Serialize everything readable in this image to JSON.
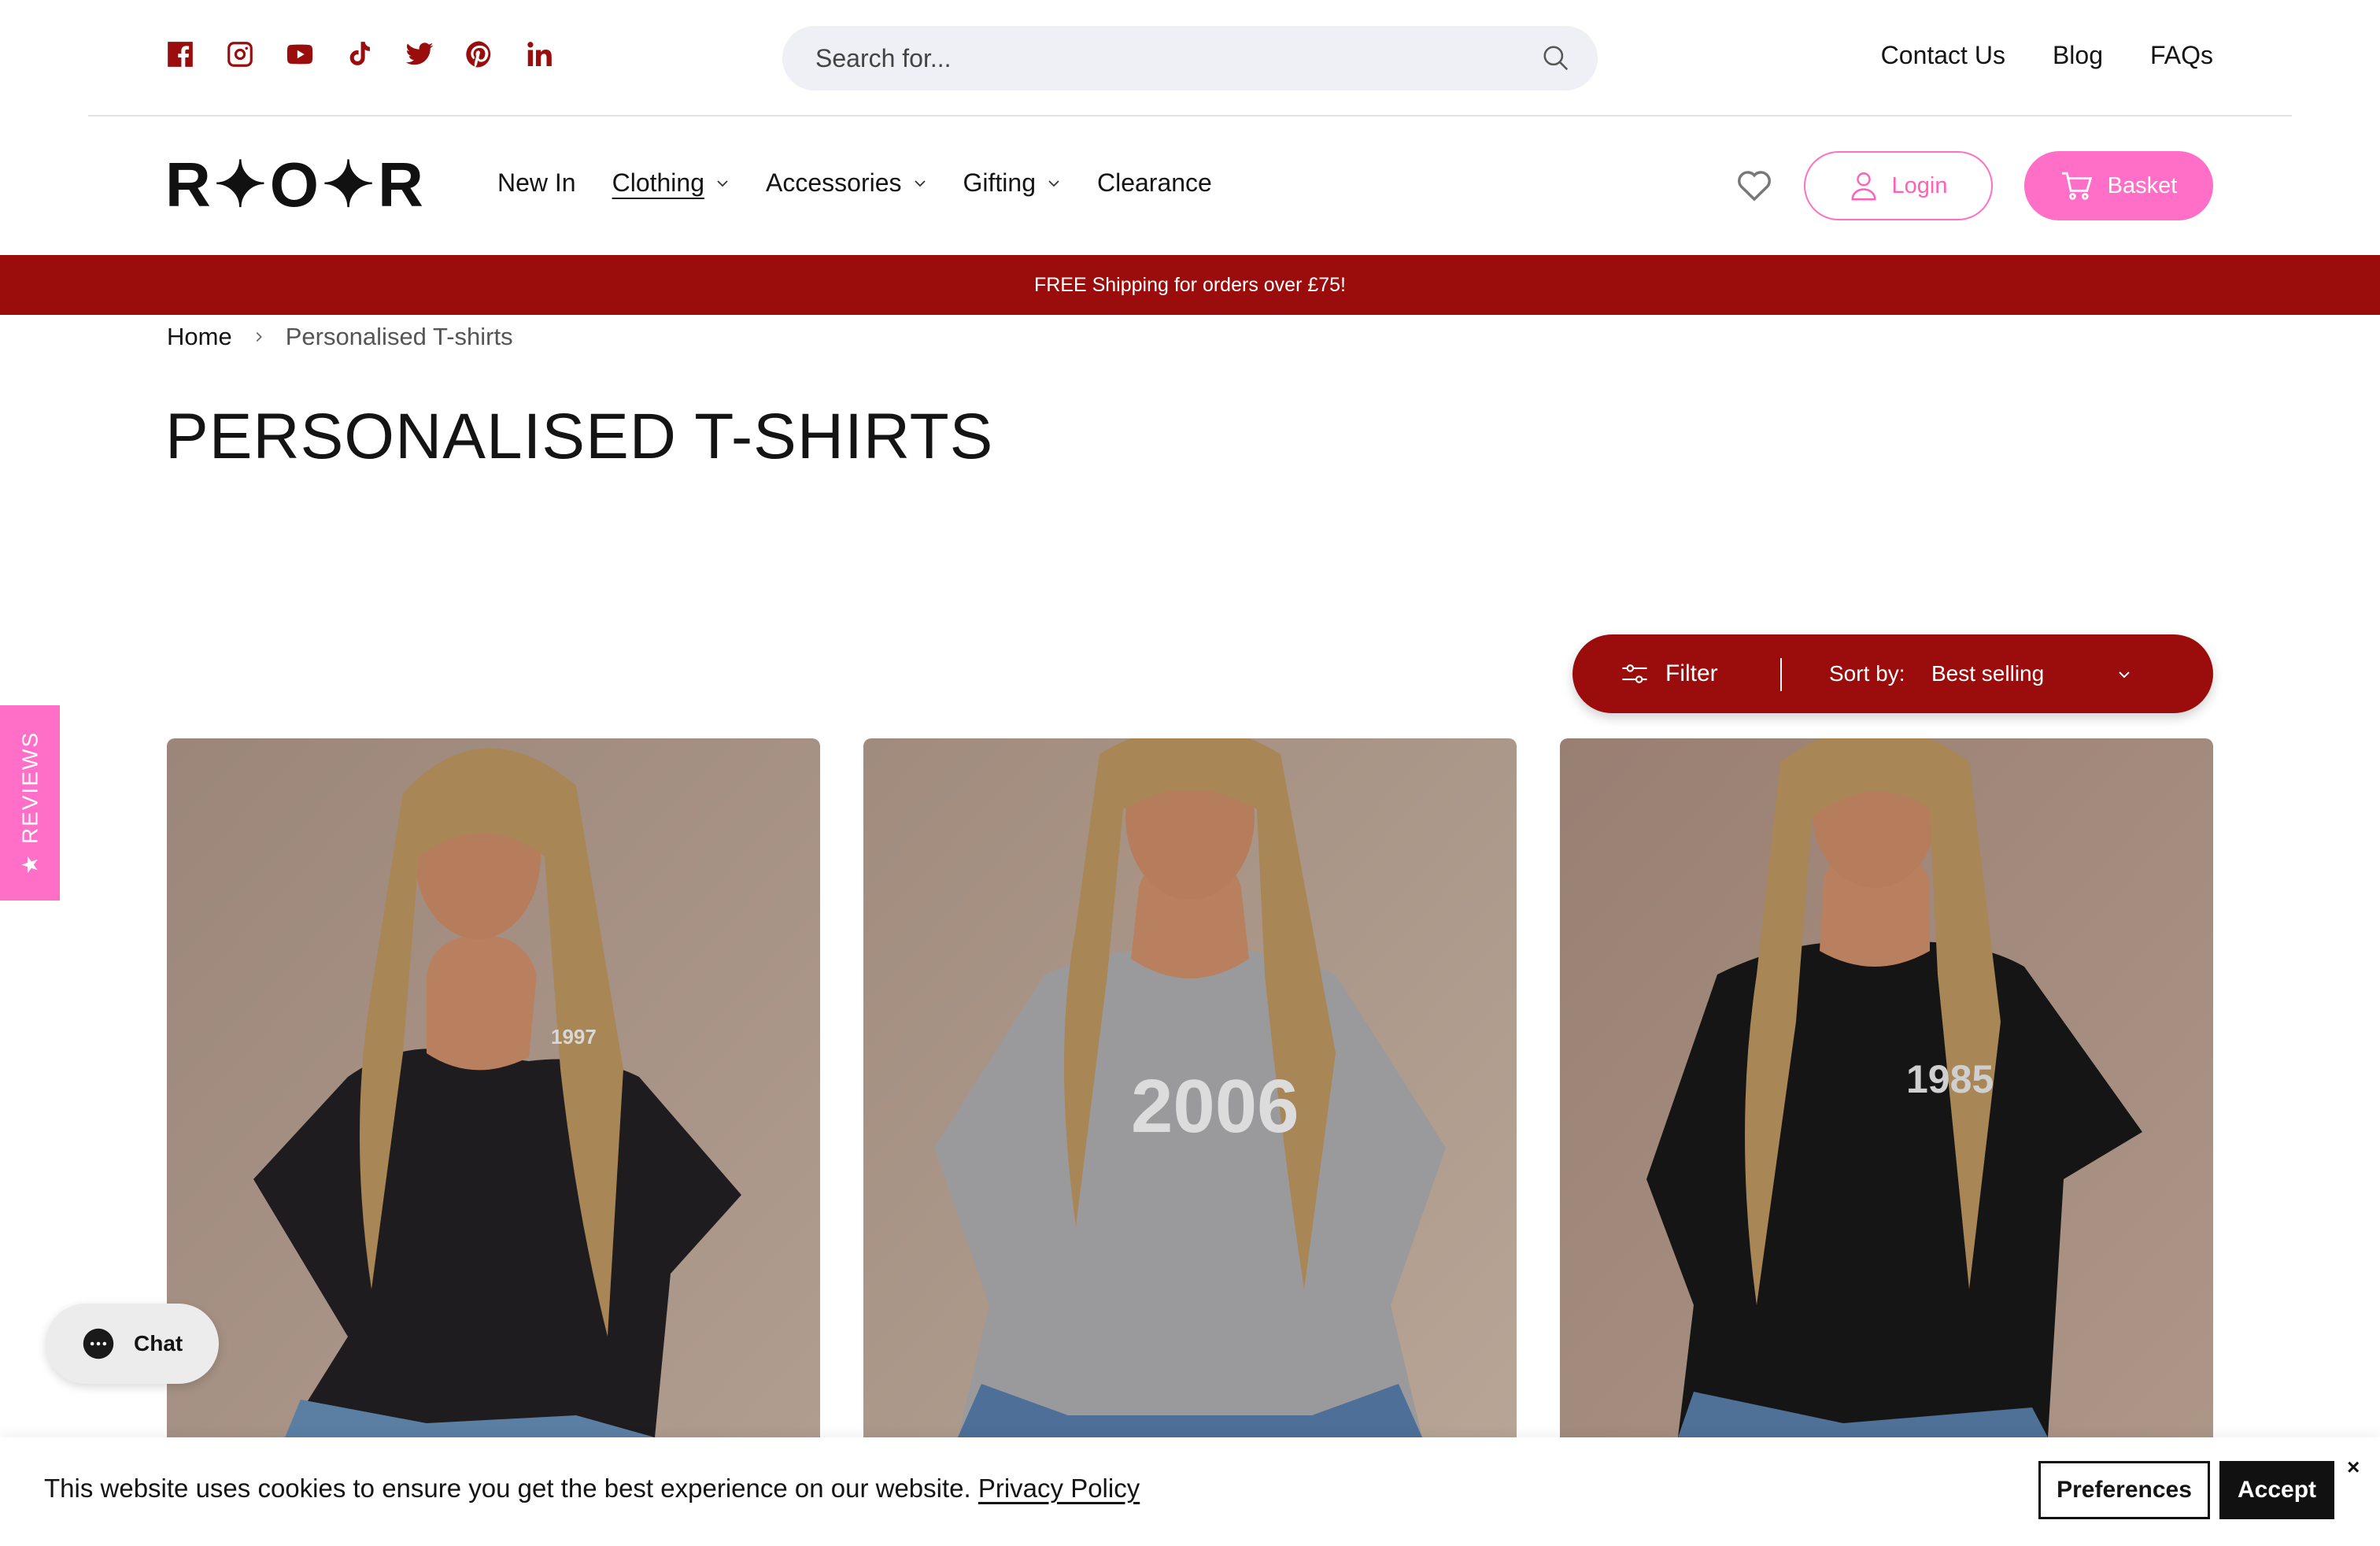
{
  "social": {
    "icons": [
      "facebook-icon",
      "instagram-icon",
      "youtube-icon",
      "tiktok-icon",
      "twitter-icon",
      "pinterest-icon",
      "linkedin-icon"
    ],
    "color": "#9b0d0d"
  },
  "search": {
    "placeholder": "Search for..."
  },
  "util_links": {
    "contact": "Contact Us",
    "blog": "Blog",
    "faqs": "FAQs"
  },
  "logo": {
    "text": "R✦O✦R"
  },
  "nav": {
    "new_in": "New In",
    "clothing": "Clothing",
    "accessories": "Accessories",
    "gifting": "Gifting",
    "clearance": "Clearance"
  },
  "header": {
    "login": "Login",
    "basket": "Basket"
  },
  "banner": {
    "text": "FREE Shipping for orders over £75!"
  },
  "breadcrumb": {
    "home": "Home",
    "current": "Personalised T-shirts"
  },
  "page": {
    "title": "PERSONALISED T-SHIRTS"
  },
  "toolbar": {
    "filter": "Filter",
    "sort_label": "Sort by:",
    "sort_value": "Best selling"
  },
  "products": [
    {
      "shirt_text": "1997",
      "shirt_color": "#1f1c20"
    },
    {
      "shirt_text": "2006",
      "shirt_color": "#9a9a9c"
    },
    {
      "shirt_text": "1985",
      "shirt_color": "#151515"
    }
  ],
  "reviews_tab": {
    "label": "REVIEWS"
  },
  "chat": {
    "label": "Chat"
  },
  "cookie": {
    "text": "This website uses cookies to ensure you get the best experience on our website.",
    "link": "Privacy Policy",
    "preferences": "Preferences",
    "accept": "Accept",
    "close": "×"
  },
  "colors": {
    "brand_red": "#9b0d0d",
    "brand_pink": "#ff6ec7"
  }
}
